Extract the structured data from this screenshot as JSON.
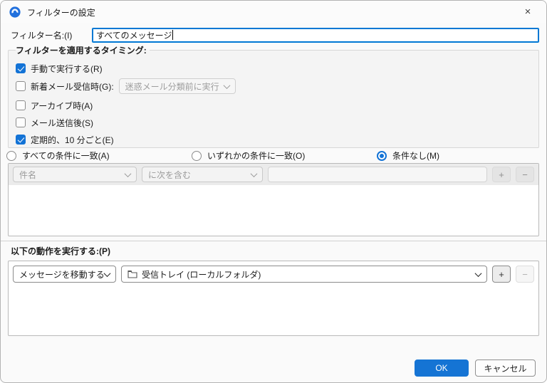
{
  "window": {
    "title": "フィルターの設定",
    "close_icon": "×",
    "app_icon": "thunderbird-logo"
  },
  "filter_name": {
    "label": "フィルター名:(I)",
    "value": "すべてのメッセージ"
  },
  "timing": {
    "legend": "フィルターを適用するタイミング:",
    "checkboxes": [
      {
        "label": "手動で実行する(R)",
        "checked": true
      },
      {
        "label": "新着メール受信時(G):",
        "checked": false,
        "dropdown_value": "迷惑メール分類前に実行",
        "dropdown_enabled": false
      },
      {
        "label": "アーカイブ時(A)",
        "checked": false
      },
      {
        "label": "メール送信後(S)",
        "checked": false
      },
      {
        "label": "定期的、10 分ごと(E)",
        "checked": true
      }
    ]
  },
  "match": {
    "options": [
      {
        "label": "すべての条件に一致(A)",
        "selected": false
      },
      {
        "label": "いずれかの条件に一致(O)",
        "selected": false
      },
      {
        "label": "条件なし(M)",
        "selected": true
      }
    ]
  },
  "conditions": {
    "field_value": "件名",
    "operator_value": "に次を含む",
    "value_text": "",
    "add_label": "+",
    "remove_label": "−",
    "enabled": false
  },
  "actions": {
    "label": "以下の動作を実行する:(P)",
    "action_value": "メッセージを移動する",
    "target_value": "受信トレイ (ローカルフォルダ)",
    "add_label": "+",
    "remove_label": "−"
  },
  "footer": {
    "ok_label": "OK",
    "cancel_label": "キャンセル"
  },
  "colors": {
    "accent": "#1373d6",
    "focus_border": "#0078d4",
    "ok_button": "#1574d4"
  }
}
